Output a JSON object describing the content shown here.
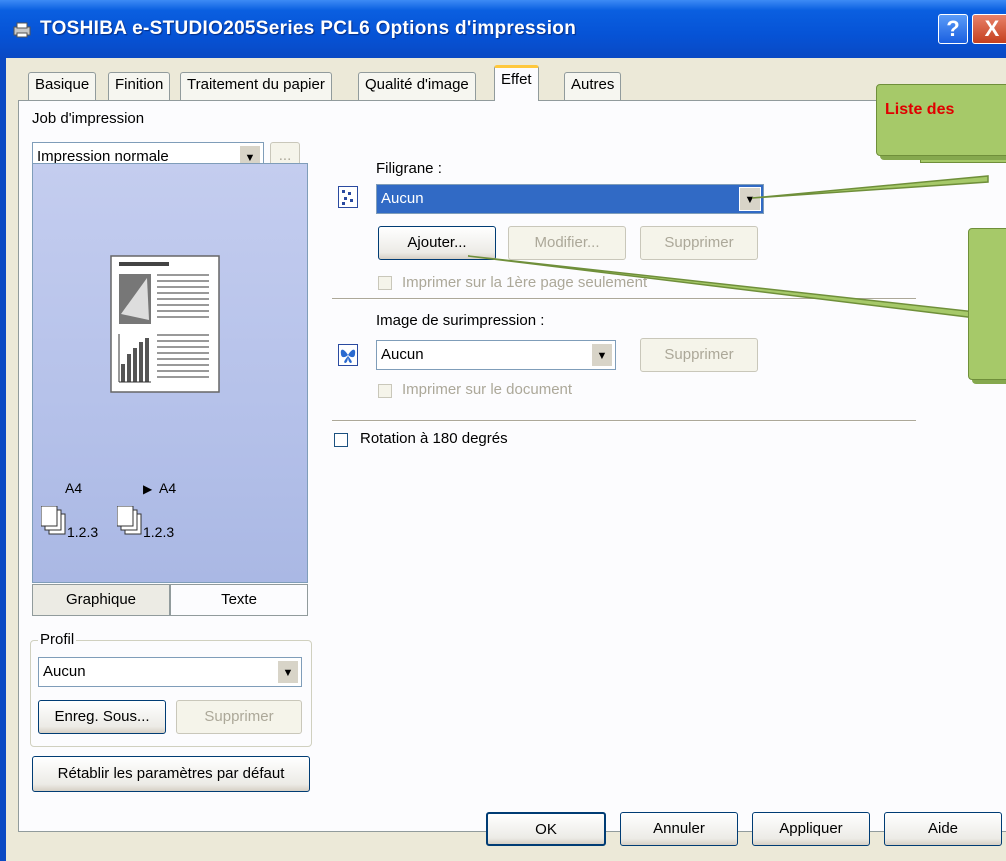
{
  "window": {
    "title": "TOSHIBA e-STUDIO205Series PCL6 Options d'impression",
    "help": "?",
    "close": "X"
  },
  "tabs": [
    {
      "label": "Basique"
    },
    {
      "label": "Finition"
    },
    {
      "label": "Traitement du papier"
    },
    {
      "label": "Qualité d'image"
    },
    {
      "label": "Effet"
    },
    {
      "label": "Autres"
    }
  ],
  "left": {
    "job_label": "Job d'impression",
    "job_value": "Impression normale",
    "job_more": "...",
    "preview": {
      "paper_in": "A4",
      "paper_out": "A4",
      "pages_in": "1.2.3",
      "pages_out": "1.2.3"
    },
    "view_tabs": {
      "graphic": "Graphique",
      "text": "Texte"
    },
    "profile": {
      "legend": "Profil",
      "value": "Aucun",
      "save": "Enreg. Sous...",
      "delete": "Supprimer"
    },
    "reset": "Rétablir les paramètres par défaut"
  },
  "watermark": {
    "label": "Filigrane :",
    "value": "Aucun",
    "add": "Ajouter...",
    "modify": "Modifier...",
    "delete": "Supprimer",
    "first_page_only": "Imprimer sur la 1ère page seulement"
  },
  "overlay": {
    "label": "Image de surimpression :",
    "value": "Aucun",
    "delete": "Supprimer",
    "print_on_doc": "Imprimer sur le document"
  },
  "rotate": {
    "label": "Rotation à 180 degrés"
  },
  "callouts": {
    "list": "Liste des"
  },
  "footer": {
    "ok": "OK",
    "cancel": "Annuler",
    "apply": "Appliquer",
    "help": "Aide"
  },
  "colors": {
    "title_blue": "#0653d6",
    "active_tab": "#ffc83c",
    "callout": "#a6c969",
    "callout_text": "#e00000",
    "selection": "#316ac5"
  }
}
